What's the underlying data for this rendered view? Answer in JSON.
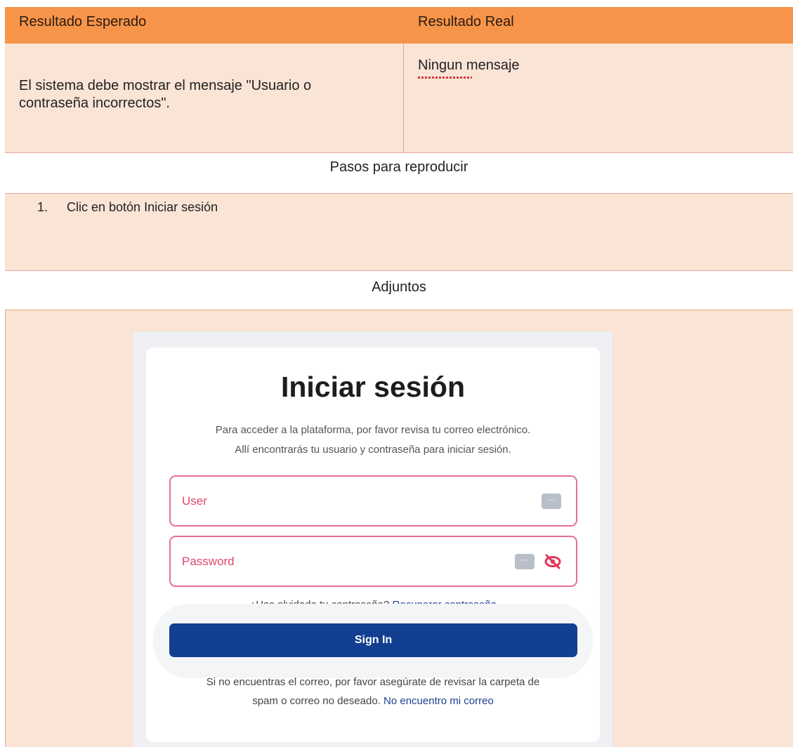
{
  "table": {
    "header": {
      "expected_label": "Resultado Esperado",
      "actual_label": "Resultado Real"
    },
    "expected_text_line1": "El sistema debe mostrar el mensaje \"Usuario o",
    "expected_text_line2": "contraseña incorrectos\".",
    "actual_text": "Ningun mensaje",
    "steps_title": "Pasos para reproducir",
    "step_number": "1.",
    "step_text": "Clic en botón Iniciar sesión",
    "attachments_title": "Adjuntos"
  },
  "login": {
    "title": "Iniciar sesión",
    "desc_line1": "Para acceder a la plataforma, por favor revisa tu correo electrónico.",
    "desc_line2": "Allí encontrarás tu usuario y contraseña para iniciar sesión.",
    "user_placeholder": "User",
    "password_placeholder": "Password",
    "forgot_text": "¿Has olvidado tu contraseña?",
    "forgot_link": "Recuperar contraseña",
    "sign_in_label": "Sign In",
    "footer_line1": "Si no encuentras el correo, por favor asegúrate de revisar la carpeta de",
    "footer_line2": "spam o correo no deseado.",
    "footer_link": "No encuentro mi correo",
    "icons": [
      "autofill-key-icon",
      "eye-off-icon"
    ]
  },
  "colors": {
    "header": "#f6954a",
    "row_peach": "#f9e4d6",
    "field_border": "#e5708f",
    "label_pink": "#e1476a",
    "button_blue": "#123f8f",
    "link_blue": "#1f3f8f"
  }
}
